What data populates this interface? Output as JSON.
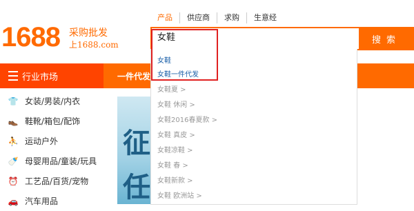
{
  "logo": {
    "number": "1688",
    "slogan": "采购批发",
    "url": "上1688.com"
  },
  "search": {
    "tabs": [
      "产品",
      "供应商",
      "求购",
      "生意经"
    ],
    "query": "女鞋",
    "button": "搜索"
  },
  "nav": {
    "categories_label": "行业市场",
    "dropship_label": "一件代发"
  },
  "categories": [
    {
      "icon": "shirt-icon",
      "glyph": "👕",
      "label": "女装/男装/内衣"
    },
    {
      "icon": "shoe-icon",
      "glyph": "👞",
      "label": "鞋靴/箱包/配饰"
    },
    {
      "icon": "sports-icon",
      "glyph": "⛹",
      "label": "运动户外"
    },
    {
      "icon": "baby-bottle-icon",
      "glyph": "🍼",
      "label": "母婴用品/童装/玩具"
    },
    {
      "icon": "alarm-clock-icon",
      "glyph": "⏰",
      "label": "工艺品/百货/宠物"
    },
    {
      "icon": "car-icon",
      "glyph": "🚗",
      "label": "汽车用品"
    }
  ],
  "suggestions": [
    {
      "text": "女鞋",
      "highlight": true
    },
    {
      "text": "女鞋一件代发",
      "highlight": true
    },
    {
      "text": "女鞋夏 >",
      "highlight": false
    },
    {
      "text": "女鞋 休闲 >",
      "highlight": false
    },
    {
      "text": "女鞋2016春夏款 >",
      "highlight": false
    },
    {
      "text": "女鞋 真皮 >",
      "highlight": false
    },
    {
      "text": "女鞋凉鞋 >",
      "highlight": false
    },
    {
      "text": "女鞋 春 >",
      "highlight": false
    },
    {
      "text": "女鞋新款 >",
      "highlight": false
    },
    {
      "text": "女鞋 欧洲站 >",
      "highlight": false
    }
  ],
  "banner": {
    "chars": [
      "征",
      "任"
    ]
  },
  "colors": {
    "brand_orange": "#ff6a00",
    "nav_red": "#ff4400",
    "highlight_red": "#e02020",
    "suggestion_blue": "#1a5fa8"
  }
}
